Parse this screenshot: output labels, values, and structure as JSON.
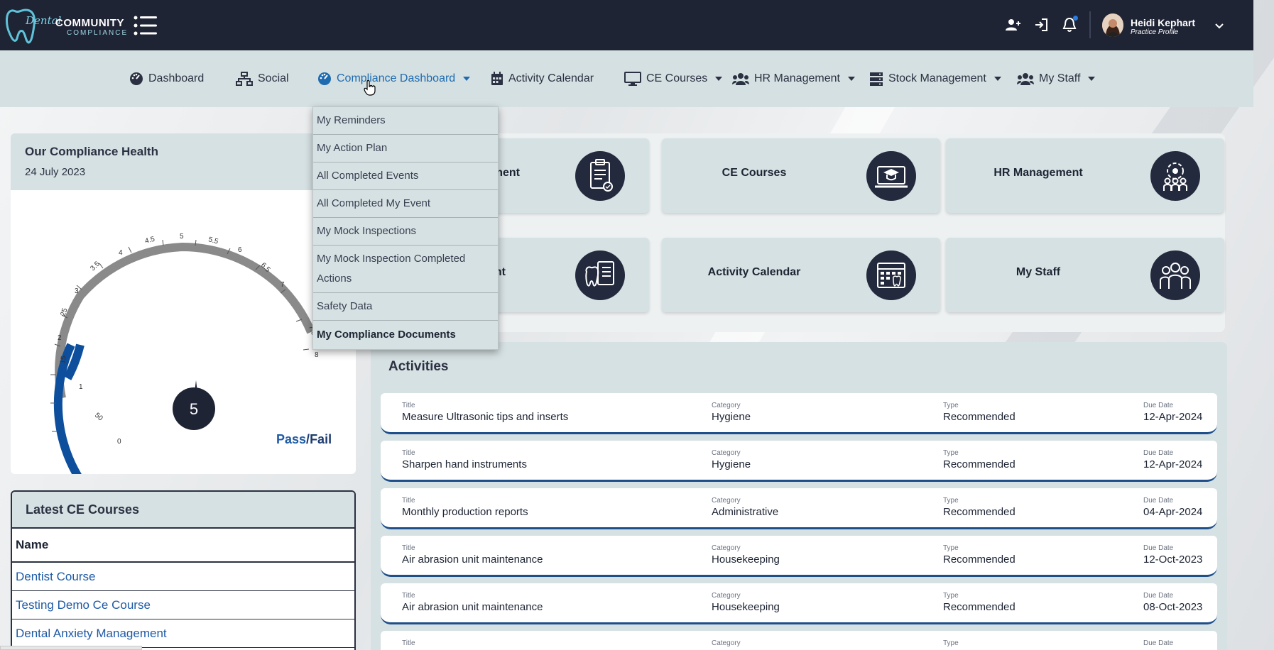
{
  "app": {
    "brand_main": "COMMUNITY",
    "brand_sub": "COMPLIANCE",
    "brand_script": "Dental"
  },
  "user": {
    "name": "Heidi Kephart",
    "role": "Practice Profile"
  },
  "nav": {
    "dashboard": "Dashboard",
    "social": "Social",
    "compliance": "Compliance Dashboard",
    "calendar": "Activity Calendar",
    "ce": "CE Courses",
    "hr": "HR Management",
    "stock": "Stock Management",
    "staff": "My Staff"
  },
  "dropdown": [
    "My Reminders",
    "My Action Plan",
    "All Completed Events",
    "All Completed My Event",
    "My Mock Inspections",
    "My Mock Inspection Completed Actions",
    "Safety Data",
    "My Compliance Documents"
  ],
  "health": {
    "title": "Our Compliance Health",
    "date": "24 July 2023",
    "score": "5",
    "pass": "Pass",
    "slash": "/",
    "fail": "Fail",
    "ticks": [
      "0",
      "50",
      "1",
      "15",
      "2",
      "25",
      "3",
      "3.5",
      "4",
      "4.5",
      "5",
      "5.5",
      "6",
      "6.5",
      "7",
      "7.5",
      "8"
    ]
  },
  "tiles": {
    "t1": "ment",
    "t2": "CE Courses",
    "t3": "HR Management",
    "t4": "nt",
    "t5": "Activity Calendar",
    "t6": "My Staff"
  },
  "ce_courses": {
    "title": "Latest CE Courses",
    "col_name": "Name",
    "rows": [
      "Dentist Course",
      "Testing Demo Ce Course",
      "Dental Anxiety Management"
    ]
  },
  "activities": {
    "title": "Activities",
    "cap_title": "Title",
    "cap_category": "Category",
    "cap_type": "Type",
    "cap_due": "Due Date",
    "rows": [
      {
        "title": "Measure Ultrasonic tips and inserts",
        "category": "Hygiene",
        "type": "Recommended",
        "due": "12-Apr-2024"
      },
      {
        "title": "Sharpen hand instruments",
        "category": "Hygiene",
        "type": "Recommended",
        "due": "12-Apr-2024"
      },
      {
        "title": "Monthly production reports",
        "category": "Administrative",
        "type": "Recommended",
        "due": "04-Apr-2024"
      },
      {
        "title": "Air abrasion unit maintenance",
        "category": "Housekeeping",
        "type": "Recommended",
        "due": "12-Oct-2023"
      },
      {
        "title": "Air abrasion unit maintenance",
        "category": "Housekeeping",
        "type": "Recommended",
        "due": "08-Oct-2023"
      },
      {
        "title": "",
        "category": "",
        "type": "",
        "due": ""
      }
    ]
  },
  "colors": {
    "topbar": "#1f2435",
    "nav": "#d5e0e2",
    "accent": "#1e6bb0",
    "gauge_blue": "#0d4f9c",
    "gauge_grey": "#8a8a8a"
  }
}
